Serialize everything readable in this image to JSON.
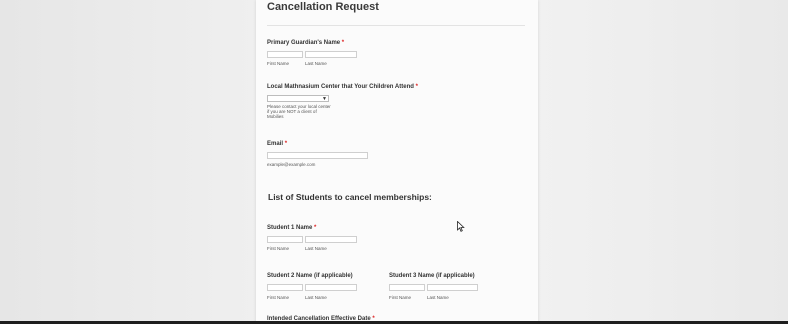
{
  "form": {
    "title": "Cancellation Request",
    "guardian": {
      "label": "Primary Guardian's Name",
      "required": "*",
      "first_sub": "First Name",
      "last_sub": "Last Name"
    },
    "center": {
      "label": "Local Mathnasium Center that Your Children Attend",
      "required": "*",
      "help": "Please contact your local center if you are NOT a client of Mobilies"
    },
    "email": {
      "label": "Email",
      "required": "*",
      "sub": "example@example.com"
    },
    "students_heading": "List of Students to cancel memberships:",
    "student1": {
      "label": "Student 1 Name",
      "required": "*",
      "first_sub": "First Name",
      "last_sub": "Last Name"
    },
    "student2": {
      "label": "Student 2 Name (if applicable)",
      "first_sub": "First Name",
      "last_sub": "Last Name"
    },
    "student3": {
      "label": "Student 3 Name (if applicable)",
      "first_sub": "First Name",
      "last_sub": "Last Name"
    },
    "cancellation_date": {
      "label": "Intended Cancellation Effective Date",
      "required": "*"
    }
  },
  "colors": {
    "required": "#dd2222",
    "panel": "#fbfbfb",
    "background": "#ececec"
  }
}
